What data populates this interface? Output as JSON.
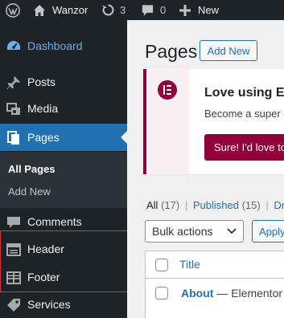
{
  "admin_bar": {
    "site_name": "Wanzor",
    "updates_count": "3",
    "comments_count": "0",
    "new_label": "New"
  },
  "sidebar": {
    "items": [
      {
        "label": "Dashboard",
        "icon": "dashboard-icon"
      },
      {
        "label": "Posts",
        "icon": "pin-icon"
      },
      {
        "label": "Media",
        "icon": "media-icon"
      },
      {
        "label": "Pages",
        "icon": "pages-icon"
      },
      {
        "label": "Comments",
        "icon": "comment-icon"
      },
      {
        "label": "Header",
        "icon": "header-template-icon"
      },
      {
        "label": "Footer",
        "icon": "footer-template-icon"
      },
      {
        "label": "Services",
        "icon": "tag-icon"
      }
    ],
    "submenu": {
      "all_pages": "All Pages",
      "add_new": "Add New"
    }
  },
  "main": {
    "title": "Pages",
    "add_new_label": "Add New",
    "notice": {
      "title": "Love using El",
      "subtitle": "Become a super c",
      "button": "Sure! I'd love to"
    },
    "filters": {
      "all_label": "All",
      "all_count": "(17)",
      "published_label": "Published",
      "published_count": "(15)",
      "draft_label": "Dra"
    },
    "bulk_actions": "Bulk actions",
    "apply_label": "Apply",
    "table": {
      "title_header": "Title",
      "rows": [
        {
          "title": "About",
          "suffix": " — Elementor"
        }
      ]
    }
  },
  "colors": {
    "admin_dark": "#1d2327",
    "wp_blue": "#2271b1",
    "elementor": "#92003b",
    "highlight": "#d63638"
  }
}
